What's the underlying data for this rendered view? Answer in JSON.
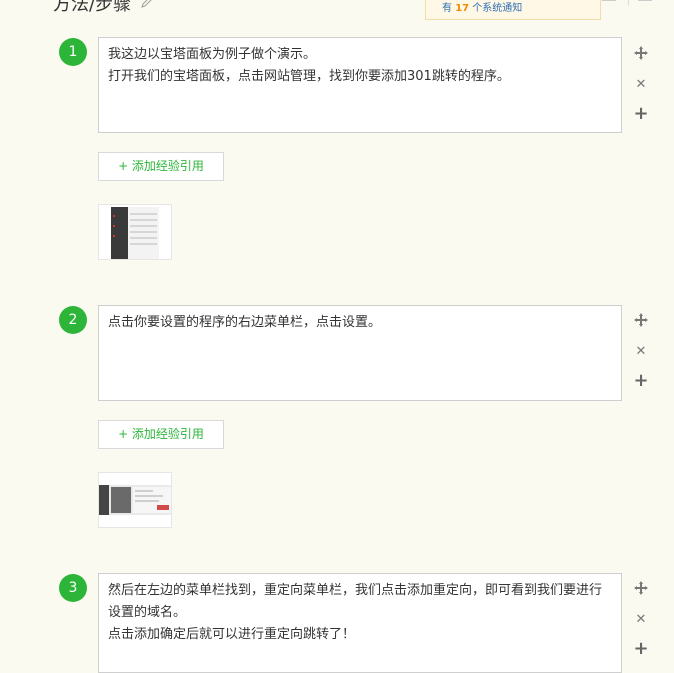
{
  "section": {
    "title": "方法/步骤"
  },
  "notification": {
    "prefix": "有",
    "count": "17",
    "suffix": "个系统通知"
  },
  "steps": [
    {
      "number": "1",
      "lines": [
        "我这边以宝塔面板为例子做个演示。",
        "打开我们的宝塔面板，点击网站管理，找到你要添加301跳转的程序。"
      ],
      "add_ref_label": "+ 添加经验引用"
    },
    {
      "number": "2",
      "lines": [
        "点击你要设置的程序的右边菜单栏，点击设置。"
      ],
      "add_ref_label": "+ 添加经验引用"
    },
    {
      "number": "3",
      "lines": [
        "然后在左边的菜单栏找到，重定向菜单栏，我们点击添加重定向，即可看到我们要进行设置的域名。",
        "点击添加确定后就可以进行重定向跳转了！"
      ]
    }
  ],
  "icons": {
    "move": "move-icon",
    "delete": "close-icon",
    "add": "plus-icon",
    "edit": "pencil-icon"
  },
  "colors": {
    "accent": "#2db53a",
    "page_bg": "#fbfaf1",
    "notice_count": "#f08a00"
  }
}
